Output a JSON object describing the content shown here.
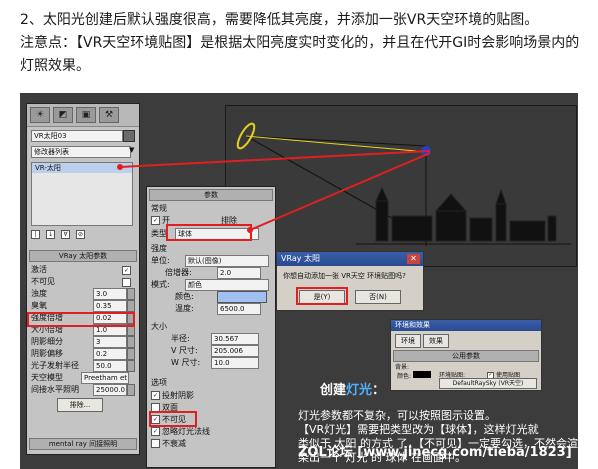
{
  "intro": {
    "line1": "2、太阳光创建后默认强度很高，需要降低其亮度，并添加一张VR天空环境的贴图。",
    "line2": "注意点：【VR天空环境贴图】是根据太阳亮度实时变化的，并且在代开GI时会影响场景内的",
    "line3": "灯照效果。"
  },
  "left_panel": {
    "toolbar_icons": [
      "sun-icon",
      "modify-icon",
      "hierarchy-icon",
      "utilities-icon"
    ],
    "object_name": "VR太阳03",
    "modifier_list": "修改器列表",
    "stack_item": "VR-太阳",
    "rollout_title": "VRay 太阳参数",
    "params": [
      {
        "label": "激活",
        "value": "",
        "checked": true
      },
      {
        "label": "不可见",
        "value": "",
        "checked": false
      },
      {
        "label": "浊度",
        "value": "3.0"
      },
      {
        "label": "臭氧",
        "value": "0.35"
      },
      {
        "label": "强度倍增",
        "value": "0.02"
      },
      {
        "label": "大小倍增",
        "value": "1.0"
      },
      {
        "label": "阴影细分",
        "value": "3"
      },
      {
        "label": "阴影偏移",
        "value": "0.2"
      },
      {
        "label": "光子发射半径",
        "value": "50.0"
      },
      {
        "label": "天空模型",
        "value": "Preetham et"
      },
      {
        "label": "间接水平照明",
        "value": "25000.0"
      }
    ],
    "exclude_button": "排除...",
    "mental_ray": "mental ray 间接照明"
  },
  "mid_panel": {
    "rollout_params": "参数",
    "general": "常规",
    "on_label": "开",
    "exclude_label": "排除",
    "type_label": "类型",
    "type_value": "球体",
    "intensity": "强度",
    "unit_label": "单位:",
    "unit_value": "默认(图像)",
    "multiplier_label": "倍增器:",
    "multiplier_value": "2.0",
    "mode_label": "模式:",
    "mode_value": "颜色",
    "color_label": "颜色:",
    "temp_label": "温度:",
    "temp_value": "6500.0",
    "size": "大小",
    "radius_label": "半径:",
    "radius_value": "30.567",
    "v_label": "V 尺寸:",
    "v_value": "205.006",
    "w_label": "W 尺寸:",
    "w_value": "10.0",
    "options": "选项",
    "opt1": "投射阴影",
    "opt2": "双面",
    "opt3": "不可见",
    "opt4": "忽略灯光法线",
    "opt5": "不衰减"
  },
  "vray_dialog": {
    "title": "VRay 太阳",
    "message": "你想自动添加一张 VR天空 环境贴图吗?",
    "yes": "是(Y)",
    "no": "否(N)"
  },
  "env_dialog": {
    "title": "环境和效果",
    "tab1": "环境",
    "tab2": "效果",
    "section": "公用参数",
    "bg": "背景:",
    "color": "颜色:",
    "env_map": "环境贴图:",
    "use_map": "使用贴图",
    "map_name": "DefaultRaySky (VR天空)"
  },
  "caption": {
    "title_prefix": "创建",
    "title_hl": "灯光",
    "title_suffix": "：",
    "line1": "灯光参数都不复杂，可以按照图示设置。",
    "line2": "【VR灯光】需要把类型改为【球体】，这样灯光就",
    "line3": "类似于 太阳 的方式 了，【不可见】一定要勾选，不然会渲",
    "line4": "染出一个 灯光 的 球体 在画面中。"
  },
  "watermark": "ZOL论坛 [www.jinecg.com/tieba/1823]"
}
